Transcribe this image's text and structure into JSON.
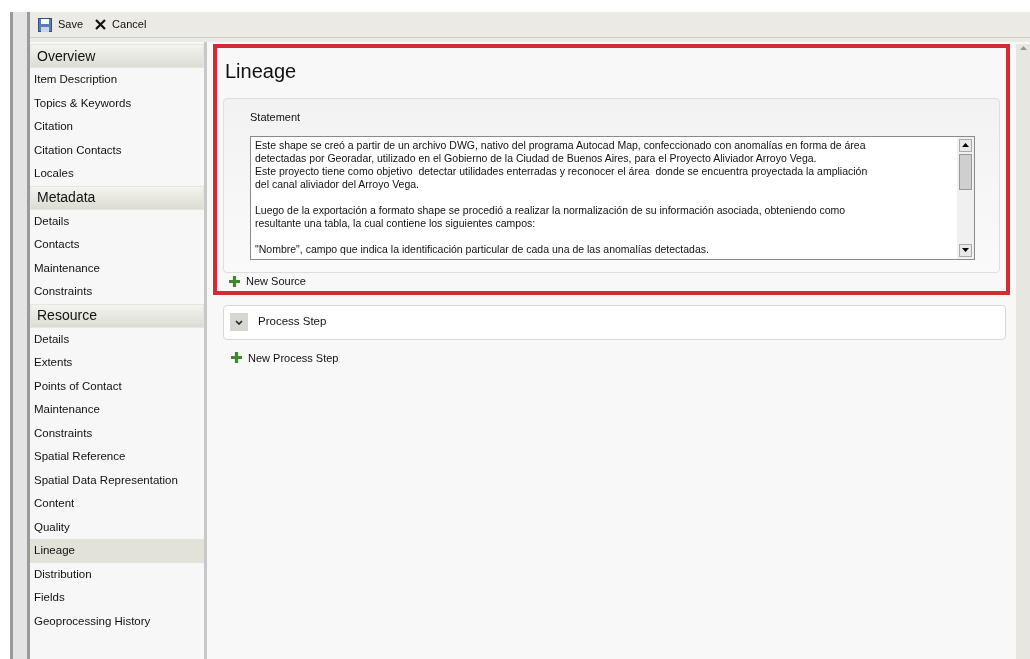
{
  "toolbar": [
    {
      "kind": "save",
      "label": "Save"
    },
    {
      "kind": "cancel",
      "label": "Cancel"
    }
  ],
  "sidebar": [
    {
      "title": "Overview",
      "items": [
        {
          "label": "Item Description",
          "selected": false
        },
        {
          "label": "Topics & Keywords",
          "selected": false
        },
        {
          "label": "Citation",
          "selected": false
        },
        {
          "label": "Citation Contacts",
          "selected": false
        },
        {
          "label": "Locales",
          "selected": false
        }
      ]
    },
    {
      "title": "Metadata",
      "items": [
        {
          "label": "Details",
          "selected": false
        },
        {
          "label": "Contacts",
          "selected": false
        },
        {
          "label": "Maintenance",
          "selected": false
        },
        {
          "label": "Constraints",
          "selected": false
        }
      ]
    },
    {
      "title": "Resource",
      "items": [
        {
          "label": "Details",
          "selected": false
        },
        {
          "label": "Extents",
          "selected": false
        },
        {
          "label": "Points of Contact",
          "selected": false
        },
        {
          "label": "Maintenance",
          "selected": false
        },
        {
          "label": "Constraints",
          "selected": false
        },
        {
          "label": "Spatial Reference",
          "selected": false
        },
        {
          "label": "Spatial Data Representation",
          "selected": false
        },
        {
          "label": "Content",
          "selected": false
        },
        {
          "label": "Quality",
          "selected": false
        },
        {
          "label": "Lineage",
          "selected": true
        },
        {
          "label": "Distribution",
          "selected": false
        },
        {
          "label": "Fields",
          "selected": false
        },
        {
          "label": "Geoprocessing History",
          "selected": false
        }
      ]
    }
  ],
  "page_title": "Lineage",
  "statement": {
    "label": "Statement",
    "paragraphs": [
      [
        "Este shape se creó a partir de un archivo DWG, nativo del programa Autocad Map, confeccionado con anomalías en forma de área",
        "detectadas por Georadar, utilizado en el Gobierno de la Ciudad de Buenos Aires, para el Proyecto Aliviador Arroyo Vega.",
        "Este proyecto tiene como objetivo  detectar utilidades enterradas y reconocer el área  donde se encuentra proyectada la ampliación",
        "del canal aliviador del Arroyo Vega."
      ],
      [
        "Luego de la exportación a formato shape se procedió a realizar la normalización de su información asociada, obteniendo como",
        "resultante una tabla, la cual contiene los siguientes campos:"
      ],
      [
        "\"Nombre\", campo que indica la identificación particular de cada una de las anomalías detectadas."
      ]
    ]
  },
  "new_source": "New Source",
  "process_step": {
    "title": "Process Step",
    "expanded": false
  },
  "new_process_step": "New Process Step"
}
